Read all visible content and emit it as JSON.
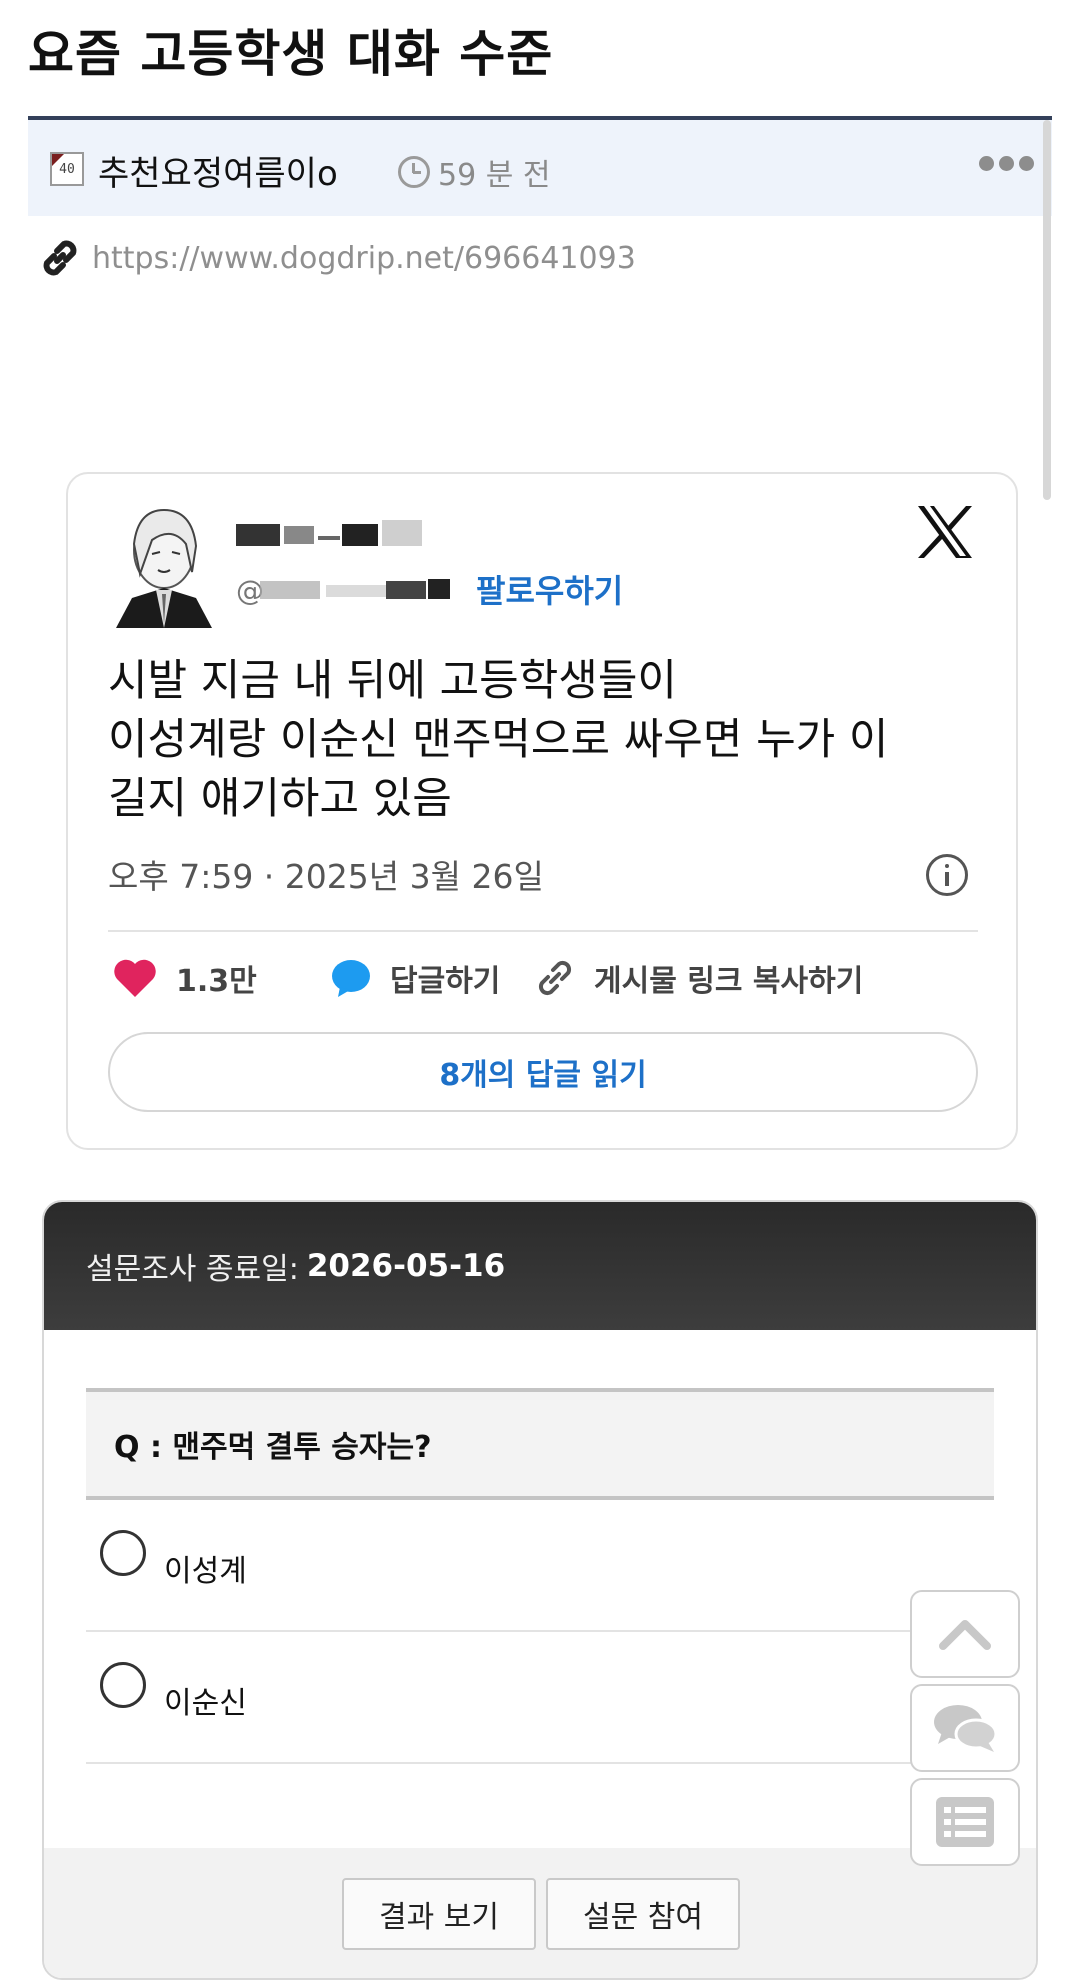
{
  "post": {
    "title": "요즘 고등학생 대화 수준",
    "level_badge": "40",
    "author": "추천요정여름이o",
    "time": "59 분 전",
    "link": "https://www.dogdrip.net/696641093"
  },
  "tweet": {
    "follow_label": "팔로우하기",
    "handle_visible_char": "@",
    "lines": [
      "시발 지금 내 뒤에 고등학생들이",
      "이성계랑 이순신 맨주먹으로 싸우면 누가 이",
      "길지 얘기하고 있음"
    ],
    "date": "오후 7:59 · 2025년 3월 26일",
    "likes": "1.3만",
    "reply_label": "답글하기",
    "copy_link_label": "게시물 링크 복사하기",
    "read_replies_label": "8개의 답글 읽기",
    "colors": {
      "accent": "#1d70c8",
      "heart": "#e0245e",
      "bubble": "#1d9bf0"
    }
  },
  "poll": {
    "end_label": "설문조사 종료일:",
    "end_date": "2026-05-16",
    "question": "Q : 맨주먹 결투 승자는?",
    "options": [
      "이성계",
      "이순신"
    ],
    "results_button": "결과 보기",
    "vote_button": "설문 참여"
  },
  "floating_buttons": [
    "chevron-up-icon",
    "comments-icon",
    "list-icon"
  ]
}
